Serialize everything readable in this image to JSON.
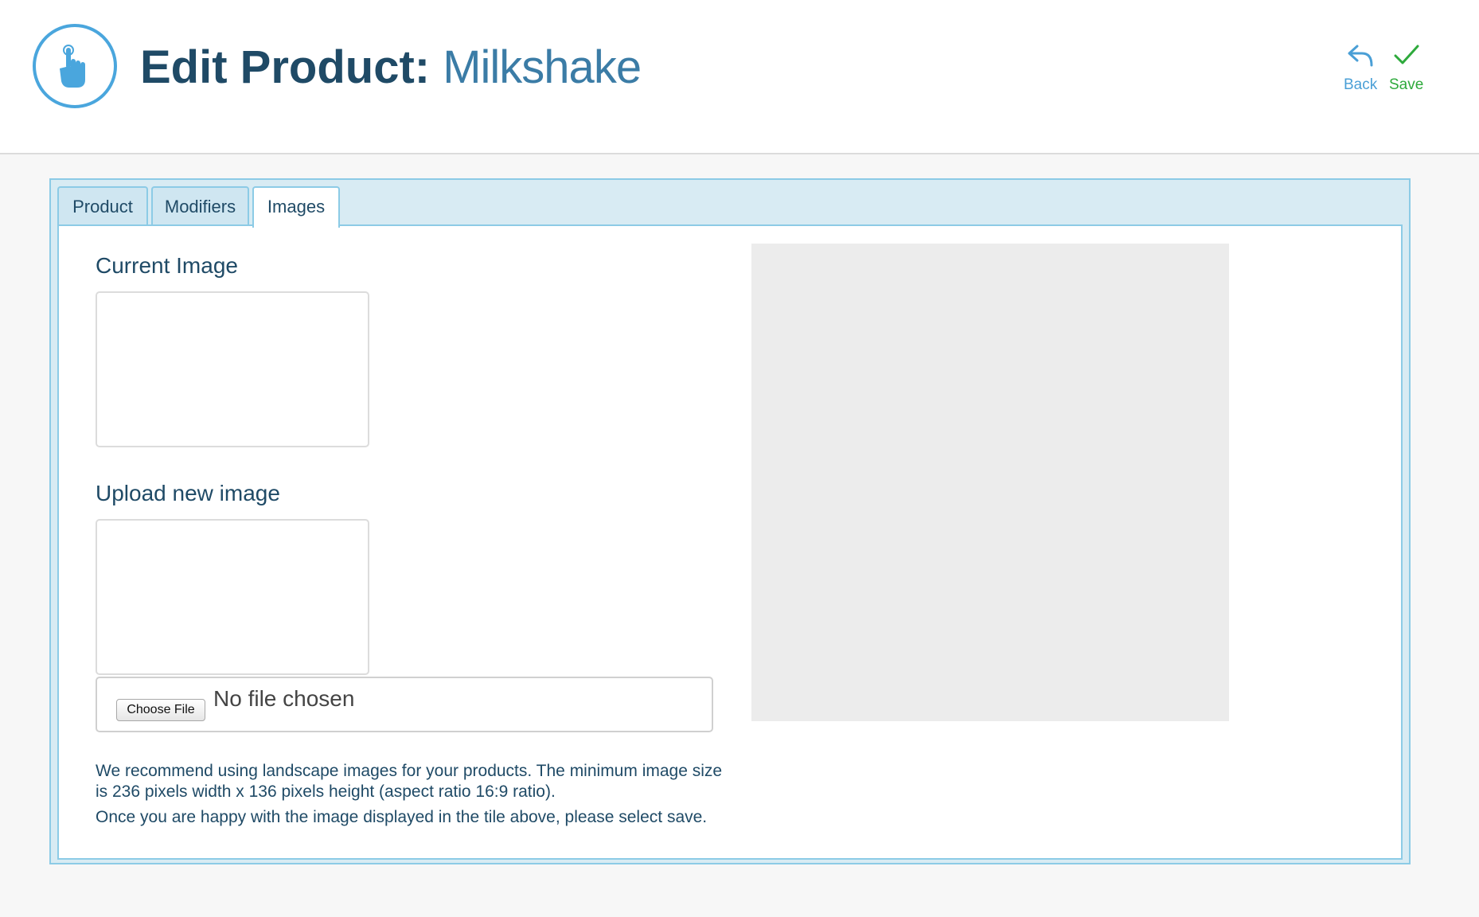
{
  "header": {
    "title_bold": "Edit Product:",
    "title_light": "Milkshake",
    "logo_icon": "pointing-hand-icon",
    "actions": {
      "back": {
        "label": "Back",
        "icon": "reply-arrow-icon",
        "color": "#4a9fd6"
      },
      "save": {
        "label": "Save",
        "icon": "checkmark-icon",
        "color": "#2eaa3c"
      }
    }
  },
  "tabs": [
    {
      "label": "Product",
      "active": false
    },
    {
      "label": "Modifiers",
      "active": false
    },
    {
      "label": "Images",
      "active": true
    }
  ],
  "images_tab": {
    "current_image_title": "Current Image",
    "upload_title": "Upload new image",
    "file_input": {
      "button_label": "Choose File",
      "status": "No file chosen"
    },
    "help_text_1": "We recommend using landscape images for your products. The minimum image size is 236 pixels width x 136 pixels height (aspect ratio 16:9 ratio).",
    "help_text_2": "Once you are happy with the image displayed in the tile above, please select save."
  },
  "colors": {
    "accent": "#4aa6dd",
    "title": "#1f4a66",
    "panel_bg": "#d8ebf3",
    "panel_border": "#8ccbe6",
    "preview_bg": "#ececec"
  }
}
